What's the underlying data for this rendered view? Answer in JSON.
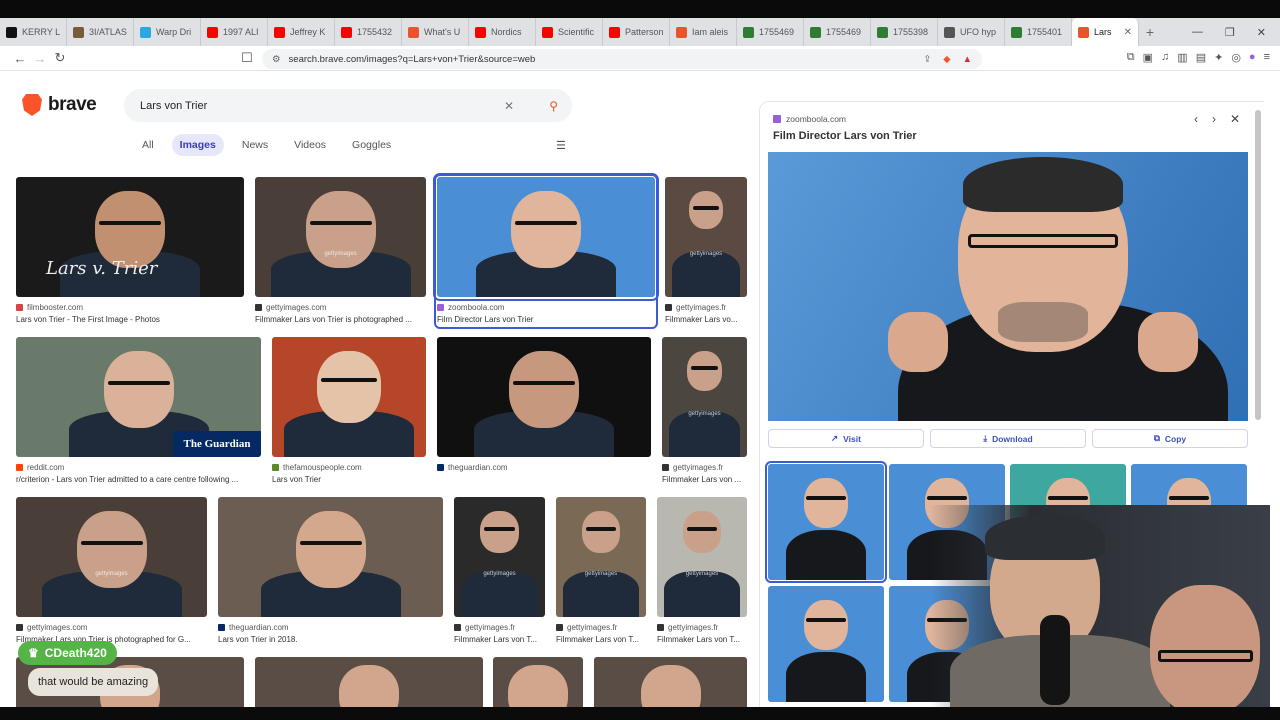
{
  "tabs": [
    {
      "label": "KERRY L",
      "color": "#111"
    },
    {
      "label": "3I/ATLAS",
      "color": "#7a5c3a"
    },
    {
      "label": "Warp Dri",
      "color": "#2aa8df"
    },
    {
      "label": "1997 ALI",
      "color": "#ff0000"
    },
    {
      "label": "Jeffrey K",
      "color": "#ff0000"
    },
    {
      "label": "1755432",
      "color": "#ff0000"
    },
    {
      "label": "What's U",
      "color": "#e8542b"
    },
    {
      "label": "Nordics",
      "color": "#ff0000"
    },
    {
      "label": "Scientific",
      "color": "#ff0000"
    },
    {
      "label": "Patterson",
      "color": "#ff0000"
    },
    {
      "label": "Iam aleis",
      "color": "#e8542b"
    },
    {
      "label": "1755469",
      "color": "#2f7d32"
    },
    {
      "label": "1755469",
      "color": "#2f7d32"
    },
    {
      "label": "1755398",
      "color": "#2f7d32"
    },
    {
      "label": "UFO hyp",
      "color": "#555"
    },
    {
      "label": "1755401",
      "color": "#2f7d32"
    },
    {
      "label": "Lars",
      "color": "#e8542b",
      "active": true
    }
  ],
  "address": {
    "url": "search.brave.com/images?q=Lars+von+Trier&source=web"
  },
  "brand": {
    "name": "brave"
  },
  "search": {
    "query": "Lars von Trier"
  },
  "nav_tabs": [
    "All",
    "Images",
    "News",
    "Videos",
    "Goggles"
  ],
  "results": [
    {
      "domain": "filmbooster.com",
      "caption": "Lars von Trier - The First Image - Photos",
      "icolor": "#d94545"
    },
    {
      "domain": "gettyimages.com",
      "caption": "Filmmaker Lars von Trier is photographed ...",
      "icolor": "#333"
    },
    {
      "domain": "zoomboola.com",
      "caption": "Film Director Lars von Trier",
      "icolor": "#9a5fd8"
    },
    {
      "domain": "gettyimages.fr",
      "caption": "Filmmaker Lars vo...",
      "icolor": "#333"
    },
    {
      "domain": "reddit.com",
      "caption": "r/criterion - Lars von Trier admitted to a care centre following ...",
      "icolor": "#ff4500"
    },
    {
      "domain": "thefamouspeople.com",
      "caption": "Lars von Trier",
      "icolor": "#5a8a2a"
    },
    {
      "domain": "theguardian.com",
      "caption": "",
      "icolor": "#052962"
    },
    {
      "domain": "gettyimages.fr",
      "caption": "Filmmaker Lars von ...",
      "icolor": "#333"
    },
    {
      "domain": "gettyimages.com",
      "caption": "Filmmaker Lars von Trier is photographed for G...",
      "icolor": "#333"
    },
    {
      "domain": "theguardian.com",
      "caption": "Lars von Trier in 2018.",
      "icolor": "#052962"
    },
    {
      "domain": "gettyimages.fr",
      "caption": "Filmmaker Lars von T...",
      "icolor": "#333"
    },
    {
      "domain": "gettyimages.fr",
      "caption": "Filmmaker Lars von T...",
      "icolor": "#333"
    },
    {
      "domain": "gettyimages.fr",
      "caption": "Filmmaker Lars von T...",
      "icolor": "#333"
    }
  ],
  "overlay_text": {
    "guardian": "The Guardian",
    "getty": "gettyimages",
    "signature": "Lars v. Trier"
  },
  "panel": {
    "domain": "zoomboola.com",
    "title": "Film Director Lars von Trier",
    "visit": "Visit",
    "download": "Download",
    "copy": "Copy"
  },
  "chat": {
    "user": "CDeath420",
    "message": "that would be amazing"
  }
}
